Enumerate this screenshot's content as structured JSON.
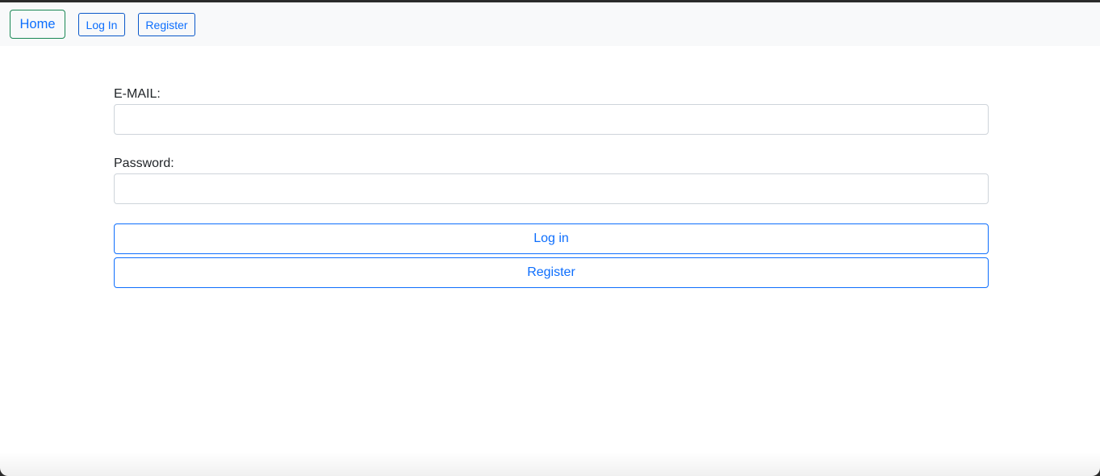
{
  "navbar": {
    "home_label": "Home",
    "login_label": "Log In",
    "register_label": "Register"
  },
  "form": {
    "email_label": "E-MAIL:",
    "email_value": "",
    "password_label": "Password:",
    "password_value": "",
    "login_button": "Log in",
    "register_button": "Register"
  },
  "colors": {
    "primary": "#0d6efd",
    "home_border": "#198754",
    "navbar_bg": "#f8f9fa",
    "input_border": "#ced4da",
    "text": "#212529"
  }
}
